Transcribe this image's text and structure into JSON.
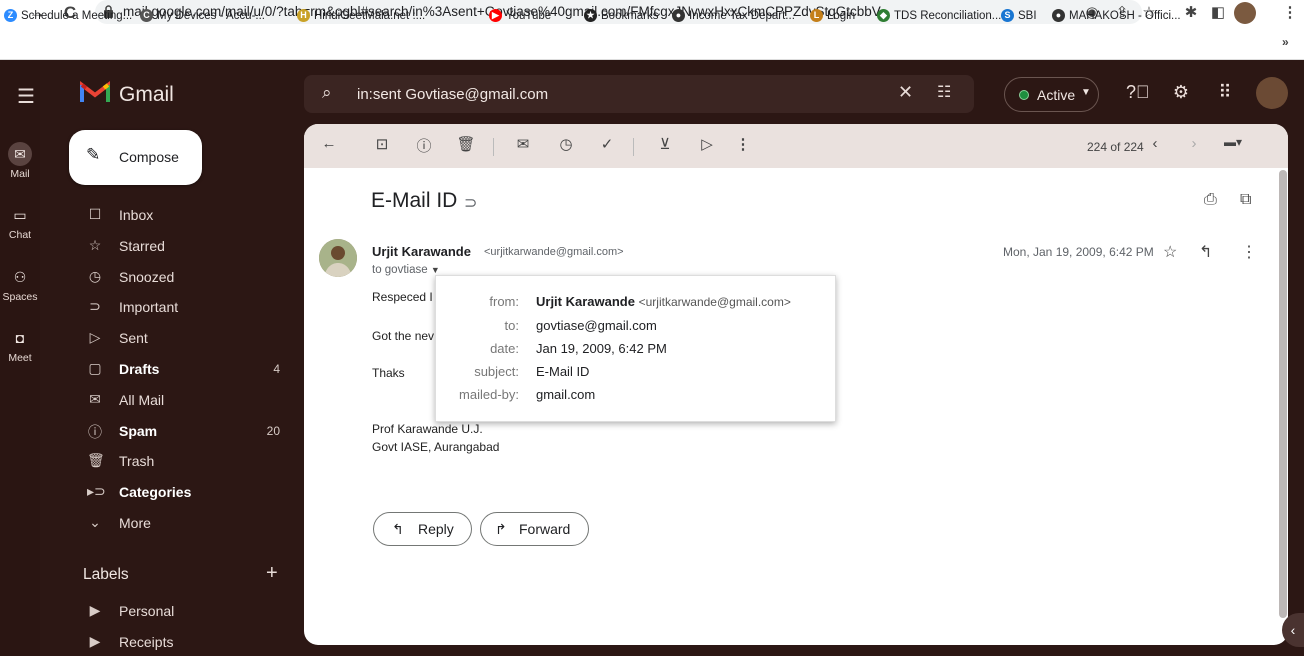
{
  "browser": {
    "url": "mail.google.com/mail/u/0/?tab=rm&ogbl#search/in%3Asent+Govtiase%40gmail.com/FMfcgxJNvwxHxxCkmCPPZdvStqGtcbbV",
    "bookmarks": [
      {
        "label": "Schedule a Meeting...",
        "icon": "Z",
        "color": "#2d8cff"
      },
      {
        "label": "My Devices - Accu-...",
        "icon": "C",
        "color": "#555555"
      },
      {
        "label": "HindiGeetMala.net :...",
        "icon": "H",
        "color": "#c9a227"
      },
      {
        "label": "YouTube",
        "icon": "▶",
        "color": "#ff0000"
      },
      {
        "label": "Bookmarks",
        "icon": "★",
        "color": "#222222"
      },
      {
        "label": "Income Tax Depart...",
        "icon": "●",
        "color": "#333333"
      },
      {
        "label": "Login",
        "icon": "L",
        "color": "#c47f1a"
      },
      {
        "label": "TDS Reconciliation...",
        "icon": "◆",
        "color": "#2e7d32"
      },
      {
        "label": "SBI",
        "icon": "S",
        "color": "#1976d2"
      },
      {
        "label": "MAHAKOSH - Offici...",
        "icon": "●",
        "color": "#333333"
      }
    ],
    "overflow": "»"
  },
  "rail": {
    "items": [
      {
        "label": "Mail",
        "icon": "mail-icon"
      },
      {
        "label": "Chat",
        "icon": "chat-icon"
      },
      {
        "label": "Spaces",
        "icon": "spaces-icon"
      },
      {
        "label": "Meet",
        "icon": "meet-icon"
      }
    ]
  },
  "header": {
    "app_name": "Gmail",
    "search_value": "in:sent Govtiase@gmail.com",
    "status": "Active"
  },
  "compose_label": "Compose",
  "nav": [
    {
      "label": "Inbox",
      "icon": "☐",
      "count": ""
    },
    {
      "label": "Starred",
      "icon": "☆",
      "count": ""
    },
    {
      "label": "Snoozed",
      "icon": "◷",
      "count": ""
    },
    {
      "label": "Important",
      "icon": "⊃",
      "count": ""
    },
    {
      "label": "Sent",
      "icon": "▷",
      "count": ""
    },
    {
      "label": "Drafts",
      "icon": "▢",
      "count": "4",
      "bold": true
    },
    {
      "label": "All Mail",
      "icon": "✉",
      "count": ""
    },
    {
      "label": "Spam",
      "icon": "ⓘ",
      "count": "20",
      "bold": true
    },
    {
      "label": "Trash",
      "icon": "🗑",
      "count": ""
    },
    {
      "label": "Categories",
      "icon": "▸⊃",
      "count": "",
      "bold": true
    },
    {
      "label": "More",
      "icon": "⌄",
      "count": ""
    }
  ],
  "labels": {
    "header": "Labels",
    "items": [
      {
        "label": "Personal"
      },
      {
        "label": "Receipts"
      }
    ]
  },
  "toolbar": {
    "page_count": "224 of 224"
  },
  "email": {
    "subject": "E-Mail ID",
    "sender_name": "Urjit Karawande",
    "sender_email": "<urjitkarwande@gmail.com>",
    "to_line": "to govtiase",
    "date": "Mon, Jan 19, 2009, 6:42 PM",
    "body": [
      "Respeced I",
      "Got the nev",
      "Thaks",
      "Prof Karawande U.J.",
      "Govt IASE, Aurangabad"
    ],
    "reply_label": "Reply",
    "forward_label": "Forward"
  },
  "details_popup": {
    "rows": [
      {
        "key": "from:",
        "name": "Urjit Karawande",
        "value": "<urjitkarwande@gmail.com>"
      },
      {
        "key": "to:",
        "value": "govtiase@gmail.com"
      },
      {
        "key": "date:",
        "value": "Jan 19, 2009, 6:42 PM"
      },
      {
        "key": "subject:",
        "value": "E-Mail ID"
      },
      {
        "key": "mailed-by:",
        "value": "gmail.com"
      }
    ]
  }
}
